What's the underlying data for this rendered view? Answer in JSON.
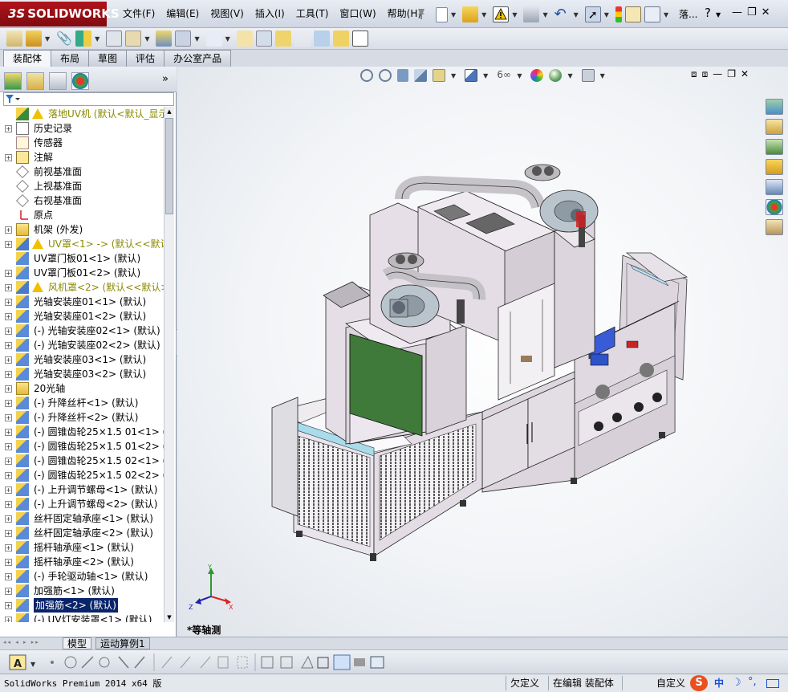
{
  "app": {
    "logo_prefix": "3S",
    "logo_text": "SOLIDWORKS",
    "menu": [
      "文件(F)",
      "编辑(E)",
      "视图(V)",
      "插入(I)",
      "工具(T)",
      "窗口(W)",
      "帮助(H)"
    ],
    "doc_title": "落...",
    "help_icon": "?"
  },
  "command_tabs": [
    "装配体",
    "布局",
    "草图",
    "评估",
    "办公室产品"
  ],
  "active_command_tab": "装配体",
  "panel": {
    "more_label": "»",
    "tree": [
      {
        "label": "落地UV机  (默认<默认_显示状",
        "exp": "none",
        "warn": true,
        "olive": true,
        "icon": "assembly-icon"
      },
      {
        "label": "历史记录",
        "exp": "plus",
        "icon": "history-icon"
      },
      {
        "label": "传感器",
        "exp": "none",
        "icon": "sensor-icon"
      },
      {
        "label": "注解",
        "exp": "plus",
        "icon": "annotation-icon"
      },
      {
        "label": "前视基准面",
        "exp": "none",
        "icon": "plane-icon"
      },
      {
        "label": "上视基准面",
        "exp": "none",
        "icon": "plane-icon"
      },
      {
        "label": "右视基准面",
        "exp": "none",
        "icon": "plane-icon"
      },
      {
        "label": "原点",
        "exp": "none",
        "icon": "origin-icon"
      },
      {
        "label": "机架 (外发)",
        "exp": "plus",
        "icon": "folder-icon"
      },
      {
        "label": "UV罩<1> -> (默认<<默认>_",
        "exp": "plus",
        "warn": true,
        "olive": true,
        "icon": "subassembly-icon"
      },
      {
        "label": "UV罩门板01<1> (默认)",
        "exp": "none",
        "icon": "part-icon"
      },
      {
        "label": "UV罩门板01<2> (默认)",
        "exp": "plus",
        "icon": "part-icon"
      },
      {
        "label": "风机罩<2> (默认<<默认>_显",
        "exp": "plus",
        "warn": true,
        "olive": true,
        "icon": "subassembly-icon"
      },
      {
        "label": "光轴安装座01<1> (默认)",
        "exp": "plus",
        "icon": "part-icon"
      },
      {
        "label": "光轴安装座01<2> (默认)",
        "exp": "plus",
        "icon": "part-icon"
      },
      {
        "label": "(-) 光轴安装座02<1> (默认)",
        "exp": "plus",
        "icon": "part-icon"
      },
      {
        "label": "(-) 光轴安装座02<2> (默认)",
        "exp": "plus",
        "icon": "part-icon"
      },
      {
        "label": "光轴安装座03<1> (默认)",
        "exp": "plus",
        "icon": "part-icon"
      },
      {
        "label": "光轴安装座03<2> (默认)",
        "exp": "plus",
        "icon": "part-icon"
      },
      {
        "label": "20光轴",
        "exp": "plus",
        "icon": "folder-icon"
      },
      {
        "label": "(-) 升降丝杆<1> (默认)",
        "exp": "plus",
        "icon": "part-icon"
      },
      {
        "label": "(-) 升降丝杆<2> (默认)",
        "exp": "plus",
        "icon": "part-icon"
      },
      {
        "label": "(-) 圆锥齿轮25×1.5 01<1> (",
        "exp": "plus",
        "icon": "part-icon"
      },
      {
        "label": "(-) 圆锥齿轮25×1.5 01<2> (",
        "exp": "plus",
        "icon": "part-icon"
      },
      {
        "label": "(-) 圆锥齿轮25×1.5 02<1> (",
        "exp": "plus",
        "icon": "part-icon"
      },
      {
        "label": "(-) 圆锥齿轮25×1.5 02<2> (",
        "exp": "plus",
        "icon": "part-icon"
      },
      {
        "label": "(-) 上升调节螺母<1> (默认)",
        "exp": "plus",
        "icon": "part-icon"
      },
      {
        "label": "(-) 上升调节螺母<2> (默认)",
        "exp": "plus",
        "icon": "part-icon"
      },
      {
        "label": "丝杆固定轴承座<1> (默认)",
        "exp": "plus",
        "icon": "part-icon"
      },
      {
        "label": "丝杆固定轴承座<2> (默认)",
        "exp": "plus",
        "icon": "part-icon"
      },
      {
        "label": "摇杆轴承座<1> (默认)",
        "exp": "plus",
        "icon": "part-icon"
      },
      {
        "label": "摇杆轴承座<2> (默认)",
        "exp": "plus",
        "icon": "part-icon"
      },
      {
        "label": "(-) 手轮驱动轴<1> (默认)",
        "exp": "plus",
        "icon": "part-icon"
      },
      {
        "label": "加强筋<1> (默认)",
        "exp": "plus",
        "icon": "part-icon"
      },
      {
        "label": "加强筋<2> (默认)",
        "exp": "plus",
        "icon": "part-icon",
        "selected": true
      },
      {
        "label": "(-) UV灯安装罩<1> (默认)",
        "exp": "plus",
        "icon": "part-icon"
      }
    ]
  },
  "viewport": {
    "view_label": "*等轴测"
  },
  "bottom_tabs": [
    "模型",
    "运动算例1"
  ],
  "status": {
    "product": "SolidWorks Premium 2014 x64 版",
    "definition": "欠定义",
    "editing": "在编辑 装配体",
    "custom": "自定义",
    "ime": "中"
  },
  "colors": {
    "accent_red": "#b0141a",
    "selection": "#0a246a",
    "machine_body": "#e6dde6",
    "machine_panel": "#c9c3cf",
    "door_green": "#3f7a3a"
  }
}
